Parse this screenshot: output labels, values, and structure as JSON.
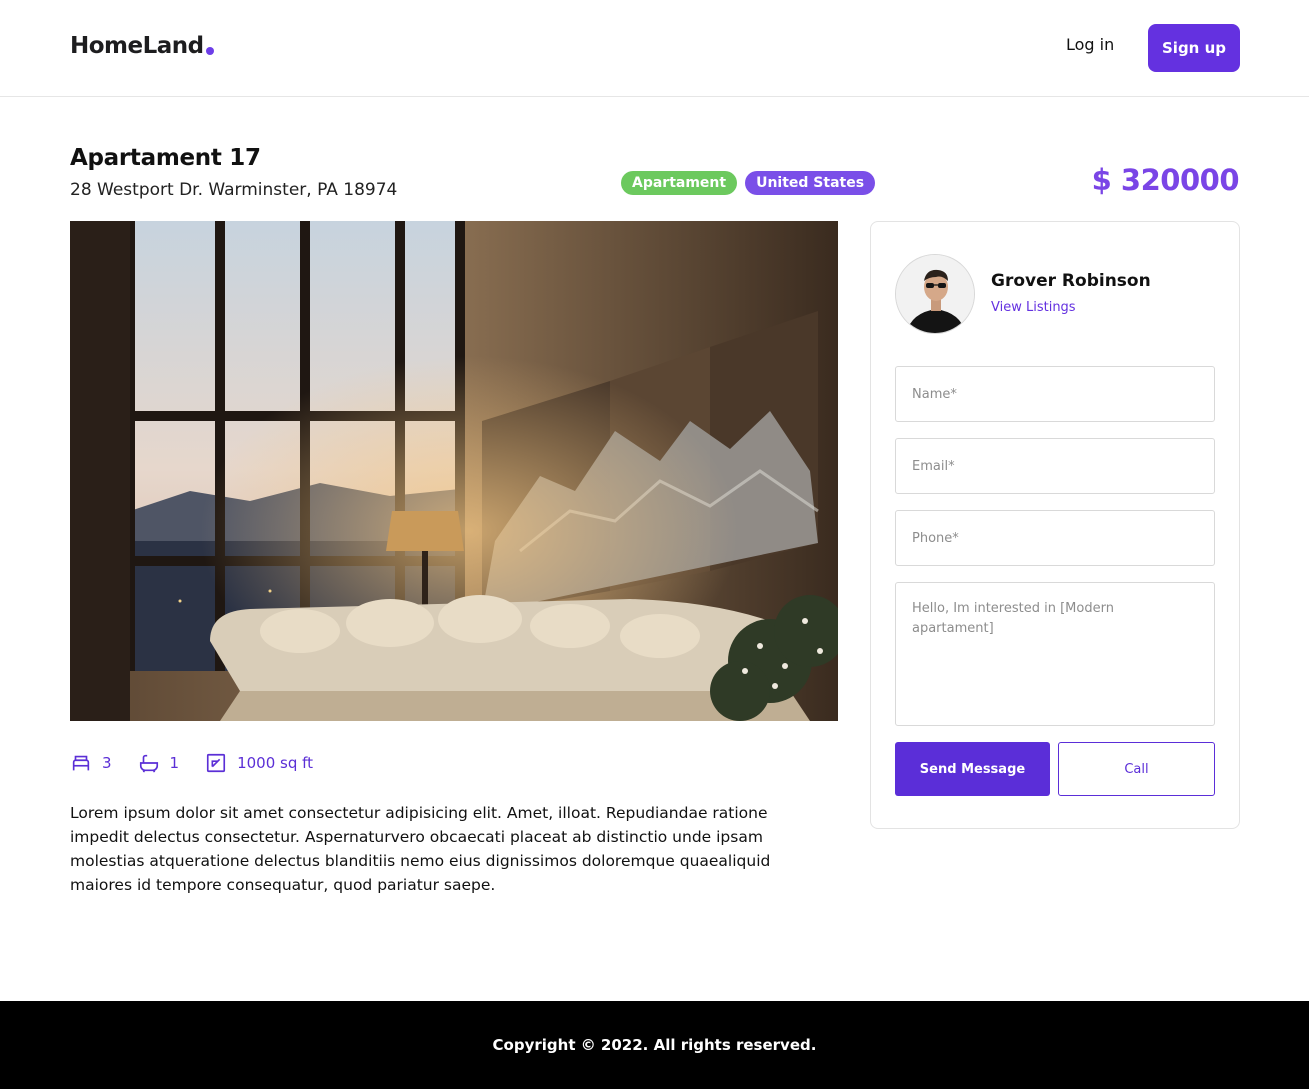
{
  "header": {
    "logo": "HomeLand",
    "login_label": "Log in",
    "signup_label": "Sign up"
  },
  "listing": {
    "title": "Apartament 17",
    "address": "28 Westport Dr. Warminster, PA 18974",
    "tags": [
      "Apartament",
      "United States"
    ],
    "price": "$ 320000",
    "features": {
      "bedrooms": "3",
      "bathrooms": "1",
      "area": "1000 sq ft"
    },
    "description": "Lorem ipsum dolor sit amet consectetur adipisicing elit. Amet, illoat. Repudiandae ratione impedit delectus consectetur. Aspernaturvero obcaecati placeat ab distinctio unde ipsam molestias atqueratione delectus blanditiis nemo eius dignissimos doloremque quaealiquid maiores id tempore consequatur, quod pariatur saepe."
  },
  "agent": {
    "name": "Grover Robinson",
    "link_label": "View Listings"
  },
  "form": {
    "name_placeholder": "Name*",
    "email_placeholder": "Email*",
    "phone_placeholder": "Phone*",
    "message_placeholder": "Hello, Im interested in [Modern apartament]",
    "send_label": "Send Message",
    "call_label": "Call"
  },
  "footer": {
    "copyright": "Copyright © 2022. All rights reserved."
  },
  "colors": {
    "accent": "#6431e0",
    "tag_green": "#6cc95e",
    "tag_purple": "#7a4fe8",
    "price": "#7a45e6"
  }
}
